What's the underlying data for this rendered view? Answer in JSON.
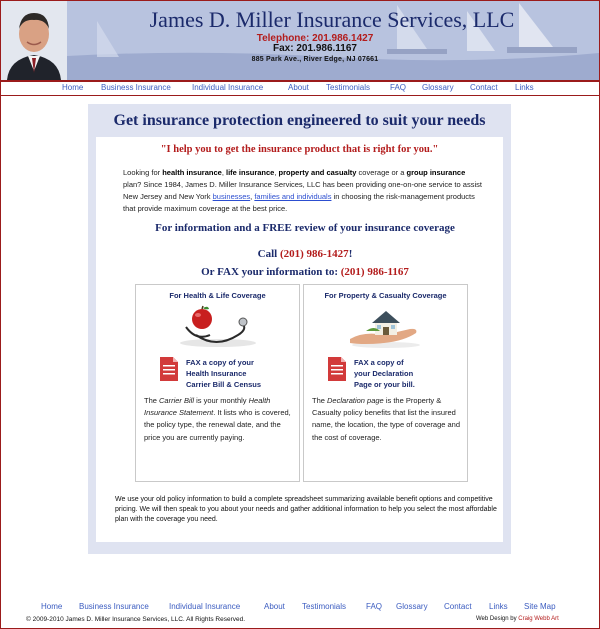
{
  "header": {
    "company_name": "James D. Miller Insurance Services, LLC",
    "telephone": "Telephone: 201.986.1427",
    "fax": "Fax: 201.986.1167",
    "address": "885 Park Ave., River Edge, NJ 07661"
  },
  "nav": {
    "items": [
      "Home",
      "Business Insurance",
      "Individual Insurance",
      "About",
      "Testimonials",
      "FAQ",
      "Glossary",
      "Contact",
      "Links"
    ]
  },
  "main": {
    "headline": "Get insurance protection engineered to suit your needs",
    "quote": "\"I help you to get the insurance product that is right for you.\"",
    "intro": {
      "p1": "Looking for ",
      "b1": "health insurance",
      "p2": ", ",
      "b2": "life insurance",
      "p3": ", ",
      "b3": "property and casualty",
      "p4": " coverage or a ",
      "b4": "group insurance",
      "p5": " plan? Since 1984, James D. Miller Insurance Services, LLC has been providing one-on-one service to assist New Jersey and New York ",
      "link1": "businesses",
      "p6": ", ",
      "link2": "families and individuals",
      "p7": " in choosing the risk-management products that provide maximum coverage at the best price."
    },
    "cta_line1": "For information and a FREE review of your insurance coverage",
    "cta_call_label": "Call ",
    "cta_call_number": "(201) 986-1427",
    "cta_call_suffix": "!",
    "cta_fax_label": "Or FAX your information to:  ",
    "cta_fax_number": "(201) 986-1167",
    "health_box": {
      "title": "For Health & Life Coverage",
      "fax_line1": "FAX a copy of your",
      "fax_line2": "Health Insurance",
      "fax_line3": "Carrier Bill & Census",
      "desc1": "The ",
      "desc_i1": "Carrier Bill",
      "desc2": " is your monthly ",
      "desc_i2": "Health Insurance Statement",
      "desc3": ". It lists who is covered, the policy type, the renewal date, and the price you are currently paying."
    },
    "property_box": {
      "title": "For Property & Casualty Coverage",
      "fax_line1": "FAX a copy of",
      "fax_line2": "your Declaration",
      "fax_line3": "Page or your bill.",
      "desc1": "The ",
      "desc_i1": "Declaration page",
      "desc2": " is the Property & Casualty policy benefits that list the insured name, the location, the type of coverage and the cost of coverage."
    },
    "summary": "We use your old policy information to build a complete spreadsheet summarizing available benefit options and competitive pricing.  We will then speak to you about your needs and gather additional information to help you select the most affordable plan with the coverage you need."
  },
  "footer": {
    "nav_items": [
      "Home",
      "Business Insurance",
      "Individual Insurance",
      "About",
      "Testimonials",
      "FAQ",
      "Glossary",
      "Contact",
      "Links",
      "Site Map"
    ],
    "copyright": "© 2009-2010 James D. Miller Insurance Services, LLC.  All Rights Reserved.",
    "credit_label": "Web Design by ",
    "credit_name": "Craig Webb Art"
  },
  "colors": {
    "brand_navy": "#1b2a6b",
    "accent_red": "#b31c1c",
    "link_blue": "#3b5cc0",
    "panel_lavender": "#dfe3f1"
  },
  "icons": {
    "health_illustration": "apple-stethoscope-illustration",
    "property_illustration": "house-in-hand-illustration",
    "document": "document-icon"
  }
}
